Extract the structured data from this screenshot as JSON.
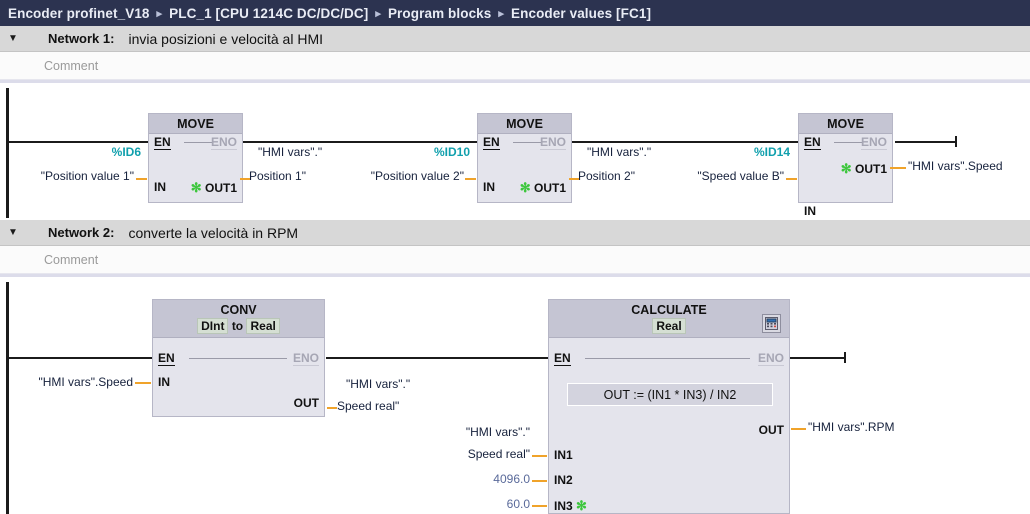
{
  "breadcrumb": {
    "items": [
      "Encoder profinet_V18",
      "PLC_1 [CPU 1214C DC/DC/DC]",
      "Program blocks",
      "Encoder values [FC1]"
    ],
    "separator": "▸"
  },
  "ui": {
    "collapse_arrow": "▼",
    "comment_placeholder": "Comment",
    "asterisk": "✻",
    "colors": {
      "titlebar": "#2c3350",
      "network_header": "#d8d8d8",
      "block_header": "#c5c5d3",
      "block_body": "#e4e4ec",
      "address_text": "#11a0ad",
      "constant_text": "#5a6a9a",
      "operand_text": "#16213c",
      "connector": "#f0a32a",
      "wire": "#1b1b1b",
      "enable_green": "#3cc63c"
    }
  },
  "networks": [
    {
      "arrow": "▼",
      "label": "Network 1:",
      "title": "invia posizioni e velocità al HMI",
      "comment": "Comment",
      "blocks": [
        {
          "name": "MOVE",
          "subtitle": "",
          "en": "EN",
          "eno": "ENO",
          "in_pin": "IN",
          "out_pin": "OUT1",
          "in_address": "%ID6",
          "in_operand": "\"Position value 1\"",
          "out_operand_line1": "\"HMI vars\".\"",
          "out_operand_line2": "Position 1\""
        },
        {
          "name": "MOVE",
          "subtitle": "",
          "en": "EN",
          "eno": "ENO",
          "in_pin": "IN",
          "out_pin": "OUT1",
          "in_address": "%ID10",
          "in_operand": "\"Position value 2\"",
          "out_operand_line1": "\"HMI vars\".\"",
          "out_operand_line2": "Position 2\""
        },
        {
          "name": "MOVE",
          "subtitle": "",
          "en": "EN",
          "eno": "ENO",
          "in_pin": "IN",
          "out_pin": "OUT1",
          "in_address": "%ID14",
          "in_operand": "\"Speed value B\"",
          "out_operand_line1": "\"HMI vars\".Speed",
          "out_operand_line2": ""
        }
      ]
    },
    {
      "arrow": "▼",
      "label": "Network 2:",
      "title": "converte la velocità in RPM",
      "comment": "Comment",
      "conv": {
        "name": "CONV",
        "sub_from": "DInt",
        "sub_to": "to",
        "sub_target": "Real",
        "en": "EN",
        "eno": "ENO",
        "in_pin": "IN",
        "out_pin": "OUT",
        "in_operand": "\"HMI vars\".Speed",
        "out_operand_line1": "\"HMI vars\".\"",
        "out_operand_line2": "Speed real\""
      },
      "calculate": {
        "name": "CALCULATE",
        "subtitle": "Real",
        "en": "EN",
        "eno": "ENO",
        "expression": "OUT :=  (IN1 * IN3) / IN2",
        "icon": "calculator-icon",
        "in1_pin": "IN1",
        "in2_pin": "IN2",
        "in3_pin": "IN3",
        "out_pin": "OUT",
        "in1_operand_line1": "\"HMI vars\".\"",
        "in1_operand_line2": "Speed real\"",
        "in2_operand": "4096.0",
        "in3_operand": "60.0",
        "out_operand": "\"HMI vars\".RPM"
      }
    }
  ]
}
